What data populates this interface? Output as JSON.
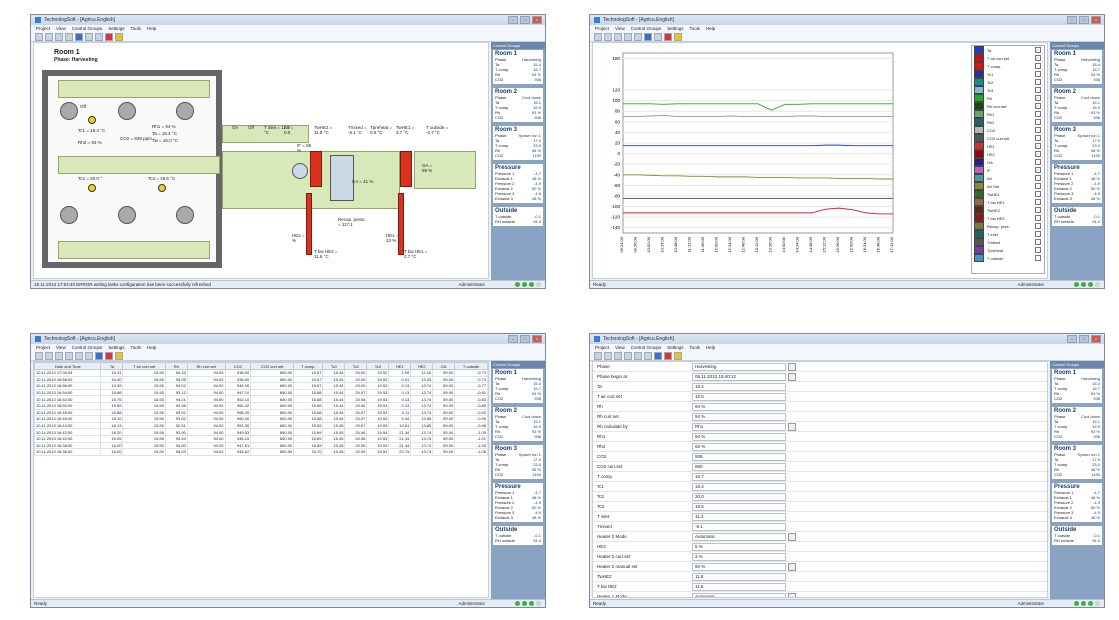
{
  "window_title": "TechnologSoft - [Agricu.English]",
  "menu": [
    "Project",
    "View",
    "Control Groups",
    "Settings",
    "Tools",
    "Help"
  ],
  "sidebar_header": "Control Groups",
  "rooms": [
    {
      "name": "Room 1",
      "rows": [
        [
          "Phase",
          "Harvesting"
        ],
        [
          "Ta",
          "15.4"
        ],
        [
          "T comp.",
          "15.7"
        ],
        [
          "Rh",
          "94 %"
        ],
        [
          "CO2",
          "938"
        ]
      ]
    },
    {
      "name": "Room 2",
      "rows": [
        [
          "Phase",
          "Cool down"
        ],
        [
          "Ta",
          "15.1"
        ],
        [
          "T comp.",
          "15.9"
        ],
        [
          "Rh",
          "93 %"
        ],
        [
          "CO2",
          "936"
        ]
      ]
    },
    {
      "name": "Room 3",
      "rows": [
        [
          "Phase",
          "Spawn run 1"
        ],
        [
          "Ta",
          "17.0"
        ],
        [
          "T comp.",
          "23.0"
        ],
        [
          "Rh",
          "98 %"
        ],
        [
          "CO2",
          "1190"
        ]
      ]
    }
  ],
  "pressure": {
    "name": "Pressure",
    "rows": [
      [
        "Pressure 1",
        "-4.7"
      ],
      [
        "Exhaust 1",
        "48 %"
      ],
      [
        "Pressure 2",
        "-4.9"
      ],
      [
        "Exhaust 2",
        "50 %"
      ],
      [
        "Pressure 3",
        "-4.9"
      ],
      [
        "Exhaust 3",
        "48 %"
      ]
    ]
  },
  "outside": {
    "name": "Outside",
    "rows": [
      [
        "T outside",
        "-0.1"
      ],
      [
        "RH outside",
        "94.0"
      ]
    ]
  },
  "status": {
    "w1_left": "18.11.2013 17:04:40 ERROR writing tasks configuration has been successfully refreshed",
    "w1_right": "Administrator",
    "ready": "Ready",
    "user": "Administrator"
  },
  "schematic": {
    "title": "Room 1",
    "phase": "Phase: Harvesting",
    "labels": {
      "tc1": "Tc1 = 19.4 °C",
      "rh2": "Rh2 = 93 %",
      "co2": "CO2 = 938 ppm",
      "rh1": "Rh1 = 94 %",
      "ta": "Ta = 15.4 °C",
      "tw": "Tw = 15.0 °C",
      "tc2": "Tc2 = 20.0 °",
      "tc3": "Tc3 = 19.5 °C",
      "tinlet": "T inlet = 11.3 °C",
      "av": "AV = 0.0",
      "if": "IF = 55 %",
      "tw_he2": "TwHE2 = 11.8 °C",
      "tmixed": "Tmixed = -8.1 °C",
      "tpreheat": "Tpreheat = 0.0 °C",
      "tw_he1": "TwHE1 = 3.7 °C",
      "toutside": "T outside = -0.7 °C",
      "oa": "OA = 59 %",
      "ca": "CA = 41 %",
      "recup": "Recup. press. = 117.1",
      "he2": "HE2 = 5 %",
      "he1": "HE1 = 13 %",
      "t_he2": "T bw HE2 = 11.6 °C",
      "t_he1": "T bw HE1 = 2.7 °C",
      "on": "On",
      "off": "Off"
    }
  },
  "chart_data": {
    "type": "line",
    "title": "",
    "xlabel": "",
    "ylabel": "",
    "x": [
      "09:24:00",
      "09:36:00",
      "10:02:00",
      "10:24:00",
      "10:48:00",
      "11:12:00",
      "11:36:00",
      "12:00:00",
      "12:24:00",
      "12:48:00",
      "13:12:00",
      "13:36:00",
      "14:00:00",
      "14:24:00",
      "14:48:00",
      "15:12:00",
      "15:36:00",
      "16:00:00",
      "16:24:00",
      "16:48:00",
      "17:12:00"
    ],
    "left_ticks": [
      "180",
      "120",
      "100",
      "80",
      "60",
      "40",
      "20",
      "0",
      "-20",
      "-40",
      "-60",
      "-80",
      "-100",
      "-120",
      "-140"
    ],
    "series": [
      {
        "name": "Ta",
        "color": "#1e3cc8",
        "values": [
          15,
          15,
          15,
          15,
          15,
          15,
          15,
          15,
          15,
          15,
          15,
          15,
          15,
          15,
          15,
          16,
          16,
          15,
          15,
          15,
          15
        ]
      },
      {
        "name": "RH",
        "color": "#22aa22",
        "values": [
          94,
          94,
          94,
          93,
          94,
          94,
          94,
          94,
          94,
          94,
          94,
          82,
          93,
          93,
          94,
          94,
          94,
          94,
          94,
          94,
          94
        ]
      },
      {
        "name": "T comp.",
        "color": "#999999",
        "values": [
          70,
          70,
          71,
          72,
          70,
          70,
          70,
          70,
          71,
          70,
          70,
          70,
          70,
          71,
          71,
          70,
          70,
          70,
          70,
          70,
          70
        ]
      },
      {
        "name": "AV Set",
        "color": "#8a8a30",
        "values": [
          -40,
          -40,
          -41,
          -42,
          -42,
          -43,
          -43,
          -44,
          -44,
          -44,
          -45,
          -45,
          -45,
          -46,
          -46,
          -46,
          -47,
          -47,
          -47,
          -48,
          -48
        ]
      },
      {
        "name": "HE2",
        "color": "#d02020",
        "values": [
          -112,
          -112,
          -112,
          -112,
          -112,
          -112,
          -112,
          -112,
          -112,
          -112,
          -112,
          -112,
          -112,
          -112,
          -112,
          -105,
          -103,
          -106,
          -112,
          -114,
          -114
        ]
      },
      {
        "name": "Tmixed",
        "color": "#555555",
        "values": [
          -85,
          -85,
          -85,
          -85,
          -85,
          -85,
          -85,
          -85,
          -85,
          -85,
          -85,
          -85,
          -85,
          -85,
          -85,
          -85,
          -85,
          -85,
          -85,
          -85,
          -85
        ]
      }
    ]
  },
  "legend": [
    {
      "label": "Ta",
      "color": "#1e3cc8",
      "checked": true
    },
    {
      "label": "T air curr.set",
      "color": "#cc1111",
      "checked": true
    },
    {
      "label": "T comp.",
      "color": "#e01010",
      "checked": false
    },
    {
      "label": "Tc1",
      "color": "#2b2b99",
      "checked": false
    },
    {
      "label": "Tc2",
      "color": "#1a8a8a",
      "checked": false
    },
    {
      "label": "Tc3",
      "color": "#7dbbd6",
      "checked": false
    },
    {
      "label": "Rh",
      "color": "#22aa22",
      "checked": true
    },
    {
      "label": "Rh curr.set",
      "color": "#144a14",
      "checked": true
    },
    {
      "label": "Rh1",
      "color": "#6aa86a",
      "checked": false
    },
    {
      "label": "Rh2",
      "color": "#1a6a6a",
      "checked": false
    },
    {
      "label": "CO2",
      "color": "#b8b8b8",
      "checked": false
    },
    {
      "label": "CO2 curr.set",
      "color": "#4a5a6a",
      "checked": false
    },
    {
      "label": "HE1",
      "color": "#d03030",
      "checked": true
    },
    {
      "label": "HE2",
      "color": "#a00000",
      "checked": true
    },
    {
      "label": "OA",
      "color": "#222288",
      "checked": false
    },
    {
      "label": "IF",
      "color": "#c060c0",
      "checked": true
    },
    {
      "label": "AV",
      "color": "#40a0a0",
      "checked": false
    },
    {
      "label": "AV Set",
      "color": "#8a8a30",
      "checked": false
    },
    {
      "label": "TwHE1",
      "color": "#2a6a2a",
      "checked": false
    },
    {
      "label": "T bw HE1",
      "color": "#9a6a3a",
      "checked": false
    },
    {
      "label": "TwHE2",
      "color": "#5a2a0a",
      "checked": false
    },
    {
      "label": "T bw HE2",
      "color": "#8a1a1a",
      "checked": false
    },
    {
      "label": "Recup. pres.",
      "color": "#7a7a3a",
      "checked": false
    },
    {
      "label": "T inlet",
      "color": "#1a6a5a",
      "checked": false
    },
    {
      "label": "Tmixed",
      "color": "#555555",
      "checked": false
    },
    {
      "label": "Tpreheat",
      "color": "#7a3aaa",
      "checked": false
    },
    {
      "label": "T outside",
      "color": "#3a9ad0",
      "checked": false
    }
  ],
  "table": {
    "headers": [
      "Date and Time",
      "Ta",
      "T air curr.set",
      "Rh",
      "Rh curr.set",
      "CO2",
      "CO2 curr.set",
      "T comp.",
      "Tc1",
      "Tc2",
      "Tc3",
      "HE1",
      "HE2",
      "OA",
      "T outside"
    ],
    "rows": [
      [
        "10.11.2013 17:00:04",
        "15.41",
        "15.55",
        "94.33",
        "94.00",
        "938.00",
        "650.00",
        "15.67",
        "15.44",
        "20.00",
        "19.52",
        "1.09",
        "12.16",
        "59.00",
        "-0.73"
      ],
      [
        "10.11.2013 16:58:00",
        "15.40",
        "15.55",
        "93.95",
        "94.00",
        "938.00",
        "650.00",
        "15.67",
        "15.44",
        "20.00",
        "19.52",
        "0.01",
        "13.33",
        "59.00",
        "-0.74"
      ],
      [
        "10.11.2013 16:56:00",
        "15.39",
        "15.55",
        "94.02",
        "94.00",
        "944.00",
        "650.00",
        "15.67",
        "15.44",
        "20.00",
        "19.53",
        "0.13",
        "13.74",
        "59.00",
        "-0.77"
      ],
      [
        "10.11.2013 16:54:00",
        "15.88",
        "15.55",
        "93.12",
        "94.00",
        "947.10",
        "650.00",
        "15.68",
        "15.44",
        "20.07",
        "19.53",
        "0.13",
        "13.74",
        "59.00",
        "-0.81"
      ],
      [
        "10.11.2013 16:52:00",
        "15.75",
        "15.55",
        "94.21",
        "94.00",
        "952.10",
        "650.00",
        "15.68",
        "15.44",
        "20.06",
        "19.53",
        "0.13",
        "13.74",
        "59.00",
        "-0.83"
      ],
      [
        "10.11.2013 16:50:00",
        "15.85",
        "15.55",
        "94.96",
        "94.00",
        "950.42",
        "650.00",
        "15.66",
        "15.44",
        "20.06",
        "19.53",
        "0.13",
        "13.74",
        "59.00",
        "-0.89"
      ],
      [
        "10.11.2013 16:48:00",
        "15.88",
        "15.55",
        "93.92",
        "94.00",
        "958.20",
        "650.00",
        "15.68",
        "15.44",
        "20.07",
        "19.53",
        "0.11",
        "13.74",
        "59.00",
        "-0.90"
      ],
      [
        "10.11.2013 16:46:00",
        "16.10",
        "15.55",
        "93.82",
        "94.00",
        "960.40",
        "650.00",
        "15.68",
        "15.44",
        "20.07",
        "19.53",
        "0.34",
        "13.85",
        "59.00",
        "-0.95"
      ],
      [
        "10.11.2013 16:44:00",
        "16.13",
        "15.55",
        "92.51",
        "94.00",
        "951.30",
        "650.00",
        "15.69",
        "15.45",
        "20.07",
        "19.53",
        "10.61",
        "13.85",
        "59.00",
        "-0.98"
      ],
      [
        "10.11.2013 16:42:00",
        "16.20",
        "15.56",
        "93.90",
        "94.00",
        "949.53",
        "650.00",
        "15.69",
        "15.45",
        "20.06",
        "19.54",
        "21.34",
        "13.74",
        "59.00",
        "-1.00"
      ],
      [
        "10.11.2013 16:40:00",
        "16.05",
        "15.56",
        "94.44",
        "94.00",
        "946.10",
        "650.00",
        "15.69",
        "15.45",
        "20.06",
        "19.53",
        "21.34",
        "13.74",
        "59.00",
        "-1.01"
      ],
      [
        "10.11.2013 16:38:00",
        "16.00",
        "15.59",
        "94.80",
        "94.00",
        "947.61",
        "650.00",
        "15.69",
        "15.45",
        "20.06",
        "19.53",
        "21.34",
        "13.74",
        "59.00",
        "-1.03"
      ],
      [
        "10.11.2013 16:36:00",
        "16.00",
        "15.59",
        "94.53",
        "94.00",
        "945.62",
        "650.00",
        "15.70",
        "15.45",
        "20.09",
        "19.53",
        "22.74",
        "13.74",
        "59.00",
        "-1.06"
      ]
    ]
  },
  "params": [
    {
      "k": "Phase",
      "v": "Harvesting",
      "dd": true
    },
    {
      "k": "Phase begin at",
      "v": "05.11.2013 15:40:12",
      "dd": true
    },
    {
      "k": "Ta",
      "v": "15.4",
      "dd": false
    },
    {
      "k": "T air curr.set",
      "v": "15.5",
      "dd": false
    },
    {
      "k": "Rh",
      "v": "94 %",
      "dd": false
    },
    {
      "k": "Rh curr.set",
      "v": "94 %",
      "dd": false
    },
    {
      "k": "Rh calculate by",
      "v": "Rh1",
      "dd": true
    },
    {
      "k": "Rh1",
      "v": "94 %",
      "dd": false
    },
    {
      "k": "Rh2",
      "v": "93 %",
      "dd": false
    },
    {
      "k": "CO2",
      "v": "938",
      "dd": false
    },
    {
      "k": "CO2 curr.set",
      "v": "650",
      "dd": false
    },
    {
      "k": "T comp.",
      "v": "15.7",
      "dd": false
    },
    {
      "k": "Tc1",
      "v": "19.4",
      "dd": false
    },
    {
      "k": "Tc2",
      "v": "20.0",
      "dd": false
    },
    {
      "k": "Tc3",
      "v": "19.5",
      "dd": false
    },
    {
      "k": "T inlet",
      "v": "11.3",
      "dd": false
    },
    {
      "k": "Tmixed",
      "v": "-8.1",
      "dd": false
    },
    {
      "k": "Heater 2 Mode",
      "v": "Automatic",
      "dd": true
    },
    {
      "k": "HE2",
      "v": "5 %",
      "dd": false
    },
    {
      "k": "Heater 2 curr.set",
      "v": "3 %",
      "dd": false
    },
    {
      "k": "Heater 2 manual set",
      "v": "50 %",
      "dd": true
    },
    {
      "k": "TwHE2",
      "v": "11.8",
      "dd": false
    },
    {
      "k": "T bw HE2",
      "v": "11.6",
      "dd": false
    },
    {
      "k": "Heater 1 Mode",
      "v": "Automatic",
      "dd": true
    },
    {
      "k": "HE1",
      "v": "13 %",
      "dd": false
    }
  ]
}
